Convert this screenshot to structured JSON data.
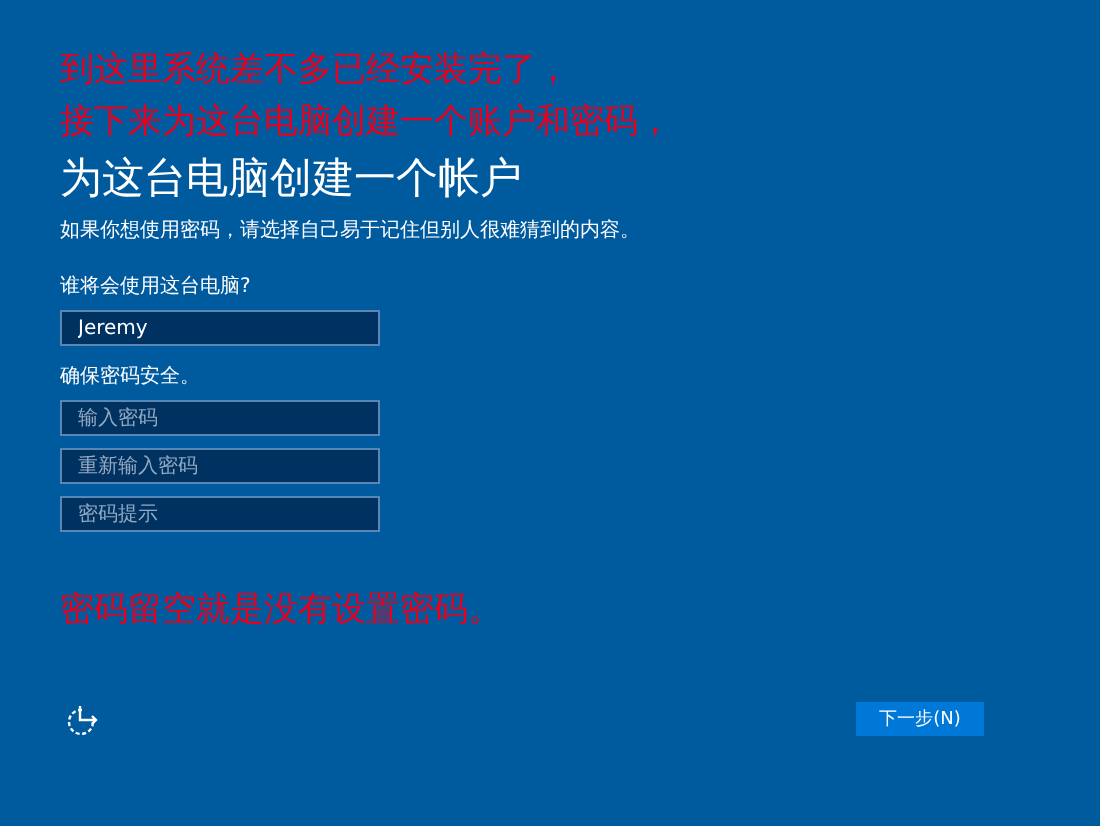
{
  "annotation_top": [
    "到这里系统差不多已经安装完了，",
    "接下来为这台电脑创建一个账户和密码，"
  ],
  "title": "为这台电脑创建一个帐户",
  "hint": "如果你想使用密码，请选择自己易于记住但别人很难猜到的内容。",
  "name_label": "谁将会使用这台电脑?",
  "name_field": {
    "value": "Jeremy"
  },
  "password_label": "确保密码安全。",
  "password_fields": [
    {
      "placeholder": "输入密码"
    },
    {
      "placeholder": "重新输入密码"
    },
    {
      "placeholder": "密码提示"
    }
  ],
  "annotation_bottom": "密码留空就是没有设置密码。",
  "next_button": "下一步(N)"
}
